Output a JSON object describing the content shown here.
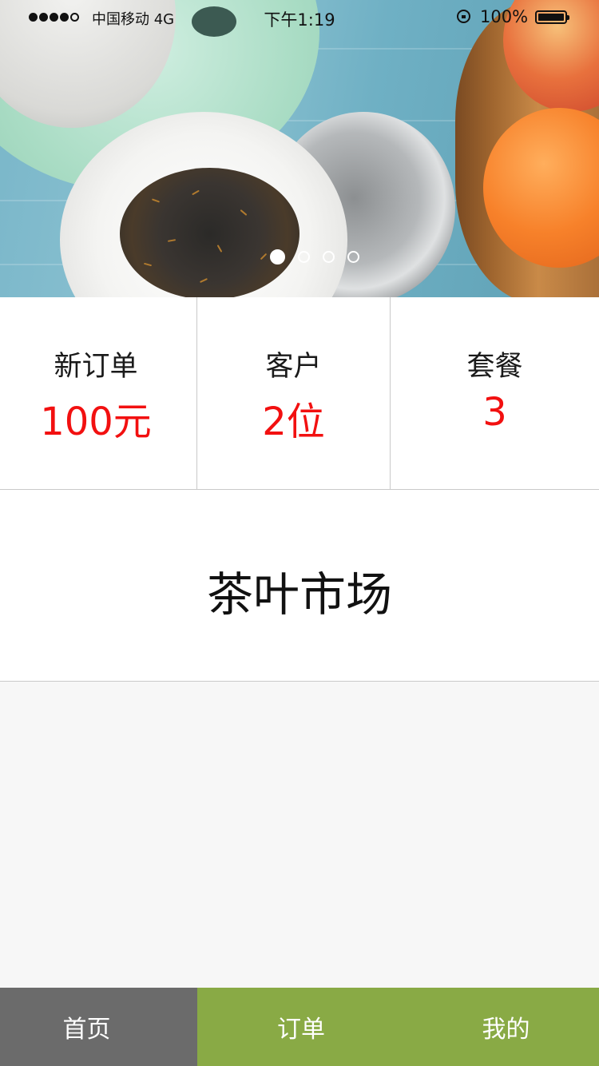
{
  "status_bar": {
    "carrier": "中国移动 4G",
    "time": "下午1:19",
    "battery": "100%"
  },
  "banner": {
    "slide_count": 4,
    "active_slide": 1
  },
  "stats": [
    {
      "label": "新订单",
      "value": "100元"
    },
    {
      "label": "客户",
      "value": "2位"
    },
    {
      "label": "套餐",
      "value": "3"
    }
  ],
  "market": {
    "title": "茶叶市场"
  },
  "tabbar": {
    "home": "首页",
    "orders": "订单",
    "mine": "我的"
  },
  "colors": {
    "accent_green": "#89aa45",
    "home_tab_gray": "#6b6b6b",
    "value_red": "#f21010"
  }
}
